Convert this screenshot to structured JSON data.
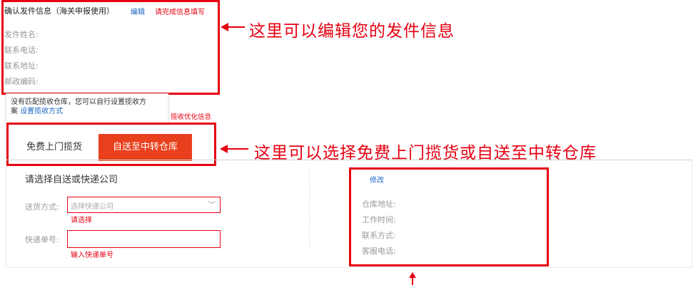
{
  "sender": {
    "title": "确认发件信息（海关申报使用）",
    "edit_link": "编辑",
    "notice": "请完成信息填写",
    "fields": [
      "发件姓名:",
      "联系电话:",
      "联系地址:",
      "邮政编码:"
    ]
  },
  "tooltip": {
    "text_line1": "没有匹配揽收仓库，您可以自行设置揽收方",
    "text_line2_prefix": "案",
    "link": "设置揽收方式"
  },
  "optimize_link": "揽收优化信息",
  "tabs": {
    "free_pickup": "免费上门揽货",
    "self_send": "自送至中转仓库"
  },
  "form": {
    "title": "请选择自送或快递公司",
    "delivery_label": "送货方式:",
    "delivery_placeholder": "选择快递公司",
    "delivery_error": "请选择",
    "tracking_label": "快递单号:",
    "tracking_value": "",
    "tracking_error": "输入快递单号"
  },
  "warehouse": {
    "modify_link": "修改",
    "fields": [
      "仓库地址:",
      "工作时间:",
      "联系方式:",
      "客服电话:"
    ]
  },
  "annotations": {
    "sender": "这里可以编辑您的发件信息",
    "tabs": "这里可以选择免费上门揽货或自送至中转仓库"
  },
  "colors": {
    "accent_red": "#e60012",
    "link_blue": "#1a66c5",
    "label_gray": "#999999"
  }
}
